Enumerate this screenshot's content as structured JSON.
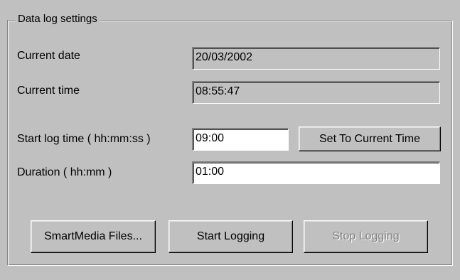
{
  "group": {
    "title": "Data log settings"
  },
  "fields": {
    "current_date": {
      "label": "Current date",
      "value": "20/03/2002"
    },
    "current_time": {
      "label": "Current time",
      "value": "08:55:47"
    },
    "start_log_time": {
      "label": "Start log time ( hh:mm:ss )",
      "value": "09:00"
    },
    "duration": {
      "label": "Duration ( hh:mm )",
      "value": "01:00"
    }
  },
  "buttons": {
    "set_to_current_time": "Set To Current Time",
    "smartmedia_files": "SmartMedia Files...",
    "start_logging": "Start Logging",
    "stop_logging": "Stop Logging"
  },
  "states": {
    "stop_logging_enabled": false
  }
}
